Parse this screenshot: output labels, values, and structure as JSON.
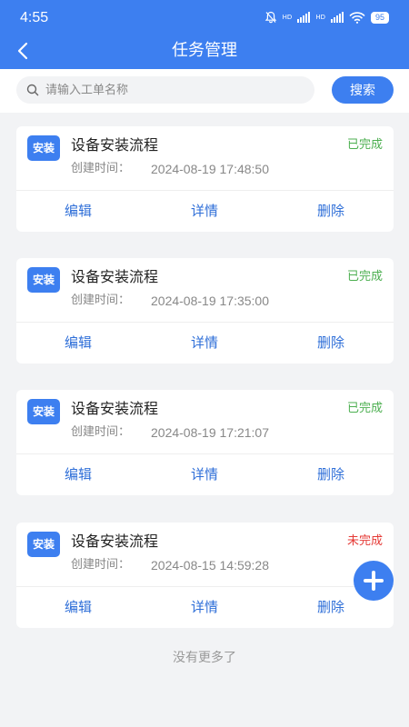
{
  "status_bar": {
    "time": "4:55",
    "network_label_1": "HD",
    "network_label_2": "HD",
    "battery": "95"
  },
  "header": {
    "title": "任务管理",
    "back_icon": "chevron-left-icon"
  },
  "search": {
    "placeholder": "请输入工单名称",
    "value": "",
    "button_label": "搜索"
  },
  "tasks": [
    {
      "badge": "安装",
      "name": "设备安装流程",
      "time_label": "创建时间：",
      "created": "2024-08-19 17:48:50",
      "status": "已完成",
      "status_color": "#4caf50",
      "edit": "编辑",
      "detail": "详情",
      "delete": "删除"
    },
    {
      "badge": "安装",
      "name": "设备安装流程",
      "time_label": "创建时间：",
      "created": "2024-08-19 17:35:00",
      "status": "已完成",
      "status_color": "#4caf50",
      "edit": "编辑",
      "detail": "详情",
      "delete": "删除"
    },
    {
      "badge": "安装",
      "name": "设备安装流程",
      "time_label": "创建时间：",
      "created": "2024-08-19 17:21:07",
      "status": "已完成",
      "status_color": "#4caf50",
      "edit": "编辑",
      "detail": "详情",
      "delete": "删除"
    },
    {
      "badge": "安装",
      "name": "设备安装流程",
      "time_label": "创建时间：",
      "created": "2024-08-15 14:59:28",
      "status": "未完成",
      "status_color": "#e53935",
      "edit": "编辑",
      "detail": "详情",
      "delete": "删除"
    }
  ],
  "footer": {
    "no_more": "没有更多了"
  },
  "colors": {
    "primary": "#3d7ff0",
    "action": "#2f6fd8",
    "completed": "#4caf50",
    "incomplete": "#e53935"
  },
  "fab_icon": "plus-icon"
}
